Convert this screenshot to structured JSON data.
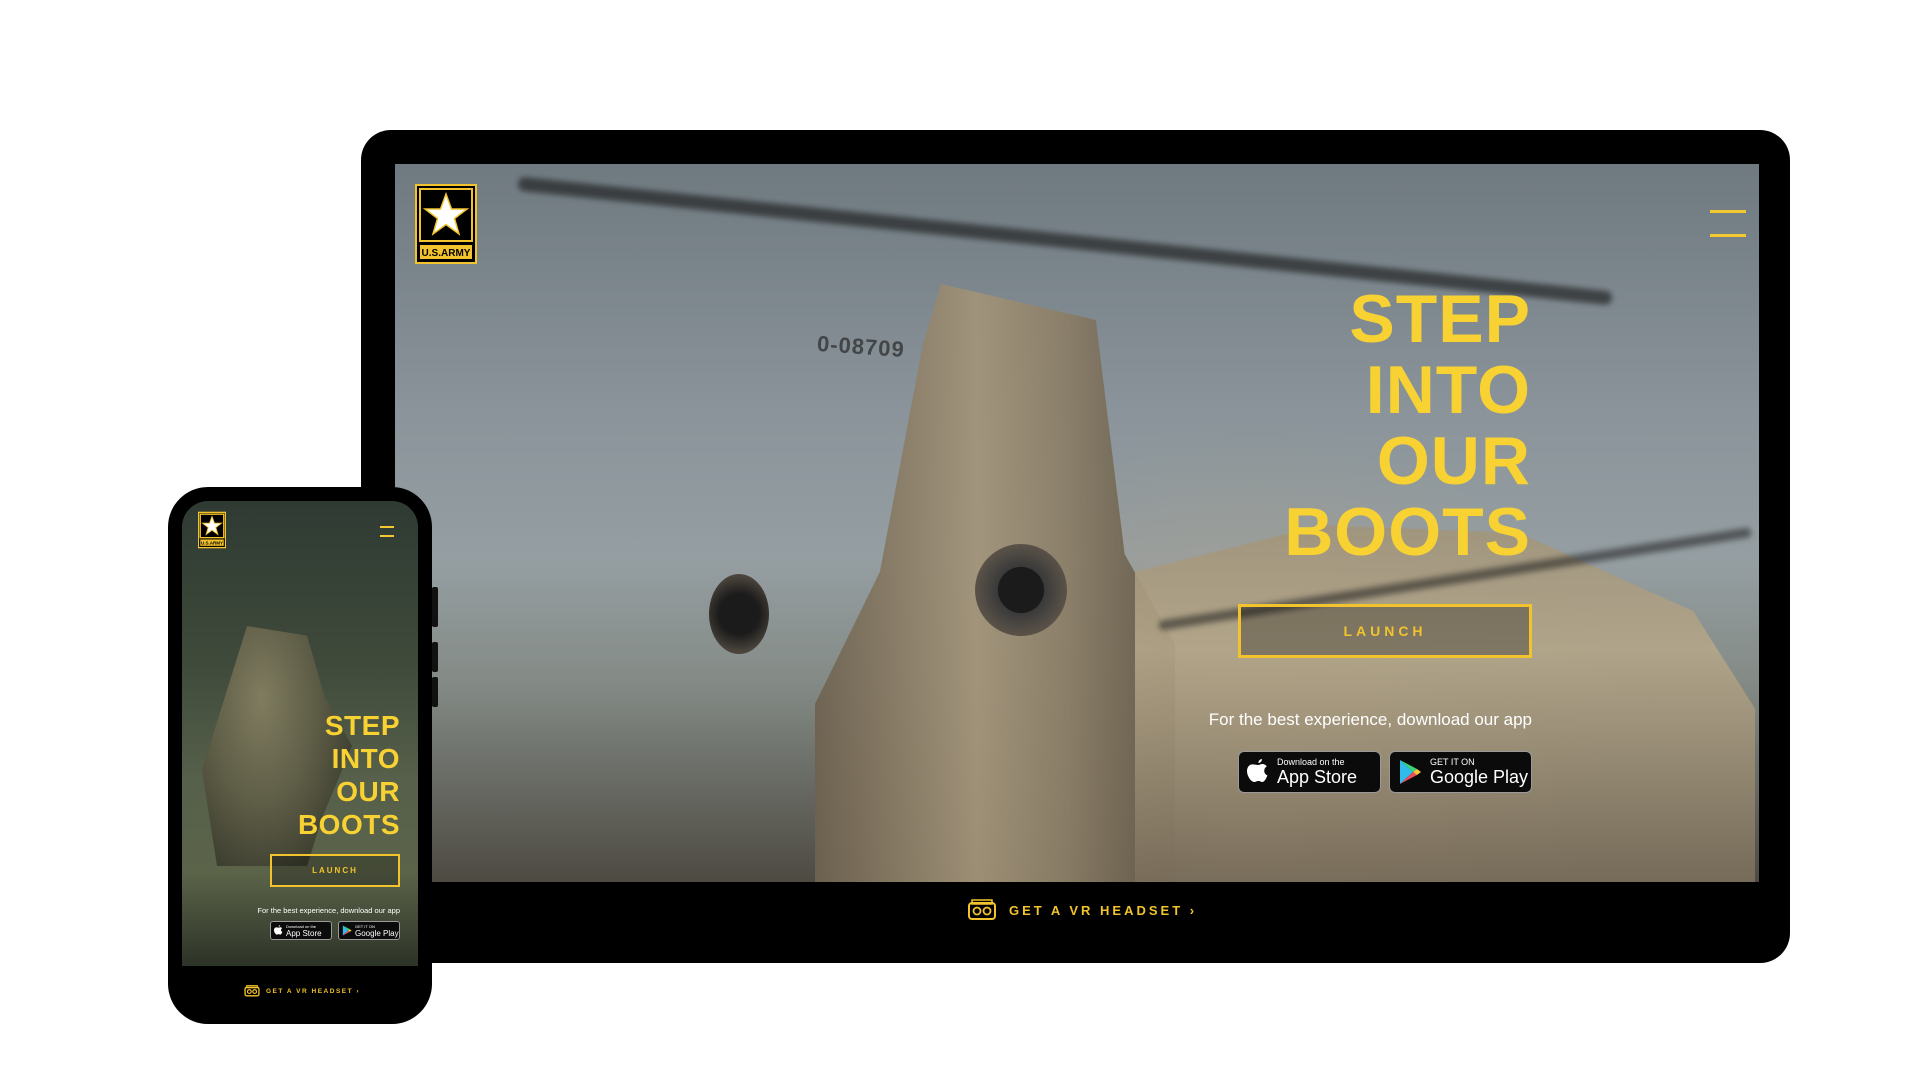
{
  "brand": {
    "logo_text": "U.S.ARMY",
    "accent_color": "#f2c32c",
    "headline_color": "#f8d133"
  },
  "hero": {
    "headline_lines": [
      "STEP",
      "INTO",
      "OUR",
      "BOOTS"
    ],
    "launch_label": "LAUNCH",
    "download_text": "For the best experience, download our app"
  },
  "app_store": {
    "small": "Download on the",
    "big": "App Store",
    "icon": "apple-icon"
  },
  "google_play": {
    "small": "GET IT ON",
    "big": "Google Play",
    "icon": "google-play-icon"
  },
  "helicopter": {
    "tail_number": "0-08709"
  },
  "footer": {
    "vr_label": "GET A VR HEADSET ›",
    "vr_icon": "vr-headset-icon"
  },
  "menu": {
    "icon": "hamburger-menu-icon"
  }
}
